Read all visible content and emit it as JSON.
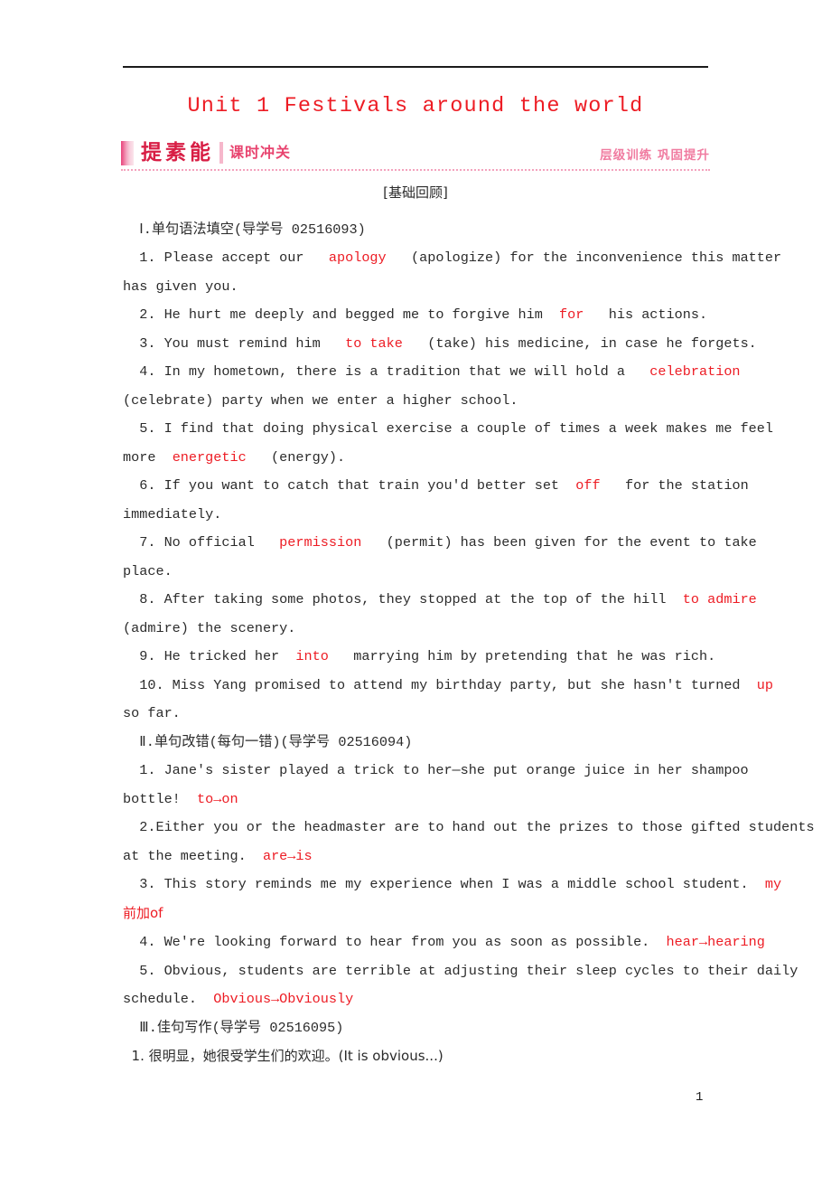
{
  "document": {
    "unit_title": "Unit 1 Festivals around the world",
    "page_number": "1"
  },
  "banner": {
    "title": "提素能",
    "subtitle": "课时冲关",
    "right_note": "层级训练 巩固提升",
    "accent_color": "#d81e45",
    "pink_color": "#f07ba0"
  },
  "section_heading": "[基础回顾]",
  "sections": [
    {
      "id": "section-1",
      "heading": "Ⅰ.单句语法填空(导学号 02516093)",
      "items": [
        {
          "lines": [
            [
              {
                "t": "  1. Please accept our   ",
                "red": false
              },
              {
                "t": "apology",
                "red": true
              },
              {
                "t": "   (apologize) for the inconvenience this matter",
                "red": false
              }
            ],
            [
              {
                "t": "has given you.",
                "red": false
              }
            ]
          ]
        },
        {
          "lines": [
            [
              {
                "t": "  2. He hurt me deeply and begged me to forgive him  ",
                "red": false
              },
              {
                "t": "for",
                "red": true
              },
              {
                "t": "   his actions.",
                "red": false
              }
            ]
          ]
        },
        {
          "lines": [
            [
              {
                "t": "  3. You must remind him   ",
                "red": false
              },
              {
                "t": "to take",
                "red": true
              },
              {
                "t": "   (take) his medicine, in case he forgets.",
                "red": false
              }
            ]
          ]
        },
        {
          "lines": [
            [
              {
                "t": "  4. In my hometown, there is a tradition that we will hold a   ",
                "red": false
              },
              {
                "t": "celebration",
                "red": true
              }
            ],
            [
              {
                "t": "(celebrate) party when we enter a higher school.",
                "red": false
              }
            ]
          ]
        },
        {
          "lines": [
            [
              {
                "t": "  5. I find that doing physical exercise a couple of times a week makes me feel",
                "red": false
              }
            ],
            [
              {
                "t": "more  ",
                "red": false
              },
              {
                "t": "energetic",
                "red": true
              },
              {
                "t": "   (energy).",
                "red": false
              }
            ]
          ]
        },
        {
          "lines": [
            [
              {
                "t": "  6. If you want to catch that train you'd better set  ",
                "red": false
              },
              {
                "t": "off",
                "red": true
              },
              {
                "t": "   for the station",
                "red": false
              }
            ],
            [
              {
                "t": "immediately.",
                "red": false
              }
            ]
          ]
        },
        {
          "lines": [
            [
              {
                "t": "  7. No official   ",
                "red": false
              },
              {
                "t": "permission",
                "red": true
              },
              {
                "t": "   (permit) has been given for the event to take",
                "red": false
              }
            ],
            [
              {
                "t": "place.",
                "red": false
              }
            ]
          ]
        },
        {
          "lines": [
            [
              {
                "t": "  8. After taking some photos, they stopped at the top of the hill  ",
                "red": false
              },
              {
                "t": "to admire",
                "red": true
              }
            ],
            [
              {
                "t": "(admire) the scenery.",
                "red": false
              }
            ]
          ]
        },
        {
          "lines": [
            [
              {
                "t": "  9. He tricked her  ",
                "red": false
              },
              {
                "t": "into",
                "red": true
              },
              {
                "t": "   marrying him by pretending that he was rich.",
                "red": false
              }
            ]
          ]
        },
        {
          "lines": [
            [
              {
                "t": "  10. Miss Yang promised to attend my birthday party, but she hasn't turned  ",
                "red": false
              },
              {
                "t": "up",
                "red": true
              }
            ],
            [
              {
                "t": "so far.",
                "red": false
              }
            ]
          ]
        }
      ]
    },
    {
      "id": "section-2",
      "heading": "Ⅱ.单句改错(每句一错)(导学号 02516094)",
      "items": [
        {
          "lines": [
            [
              {
                "t": "  1. Jane's sister played a trick to her—she put orange juice in her shampoo",
                "red": false
              }
            ],
            [
              {
                "t": "bottle!  ",
                "red": false
              },
              {
                "t": "to→on",
                "red": true
              }
            ]
          ]
        },
        {
          "lines": [
            [
              {
                "t": "  2.Either you or the headmaster are to hand out the prizes to those gifted students",
                "red": false
              }
            ],
            [
              {
                "t": "at the meeting.  ",
                "red": false
              },
              {
                "t": "are→is",
                "red": true
              }
            ]
          ]
        },
        {
          "lines": [
            [
              {
                "t": "  3. This story reminds me my experience when I was a middle school student.  ",
                "red": false
              },
              {
                "t": "my",
                "red": true
              }
            ],
            [
              {
                "t": "前加of",
                "red": true,
                "cn": true
              }
            ]
          ]
        },
        {
          "lines": [
            [
              {
                "t": "  4. We're looking forward to hear from you as soon as possible.  ",
                "red": false
              },
              {
                "t": "hear→hearing",
                "red": true
              }
            ]
          ]
        },
        {
          "lines": [
            [
              {
                "t": "  5. Obvious, students are terrible at adjusting their sleep cycles to their daily",
                "red": false
              }
            ],
            [
              {
                "t": "schedule.  ",
                "red": false
              },
              {
                "t": "Obvious→Obviously",
                "red": true
              }
            ]
          ]
        }
      ]
    },
    {
      "id": "section-3",
      "heading": "Ⅲ.佳句写作(导学号 02516095)",
      "items": [
        {
          "lines": [
            [
              {
                "t": "  1. 很明显，她很受学生们的欢迎。(It is obvious...)",
                "red": false,
                "cn": true
              }
            ]
          ]
        }
      ]
    }
  ]
}
